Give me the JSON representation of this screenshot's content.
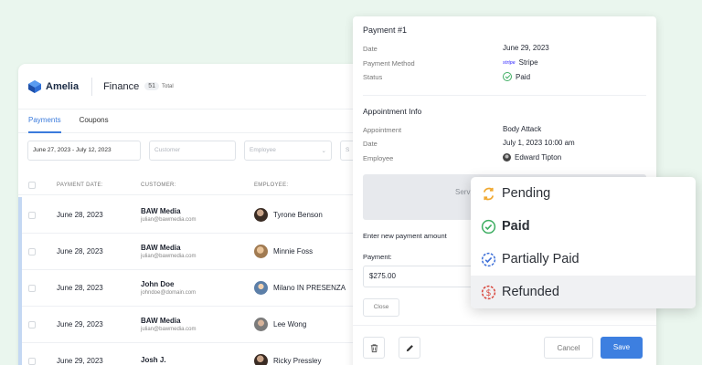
{
  "app": {
    "logo_text": "Amelia",
    "section_title": "Finance",
    "total_count": "51",
    "total_label": "Total"
  },
  "tabs": [
    {
      "label": "Payments",
      "active": true
    },
    {
      "label": "Coupons",
      "active": false
    }
  ],
  "filters": {
    "date_range": "June 27, 2023 - July 12, 2023",
    "customer_placeholder": "Customer",
    "employee_placeholder": "Employee",
    "next_placeholder": "S"
  },
  "table": {
    "headers": [
      "PAYMENT DATE:",
      "CUSTOMER:",
      "EMPLOYEE:"
    ],
    "rows": [
      {
        "date": "June 28, 2023",
        "customer": "BAW Media",
        "email": "julian@bawmedia.com",
        "employee": "Tyrone Benson"
      },
      {
        "date": "June 28, 2023",
        "customer": "BAW Media",
        "email": "julian@bawmedia.com",
        "employee": "Minnie Foss"
      },
      {
        "date": "June 28, 2023",
        "customer": "John Doe",
        "email": "johndoe@domain.com",
        "employee": "Milano IN PRESENZA"
      },
      {
        "date": "June 29, 2023",
        "customer": "BAW Media",
        "email": "julian@bawmedia.com",
        "employee": "Lee Wong"
      },
      {
        "date": "June 29, 2023",
        "customer": "Josh J.",
        "email": "",
        "employee": "Ricky Pressley"
      }
    ]
  },
  "payment": {
    "title": "Payment #1",
    "date_label": "Date",
    "date_value": "June 29, 2023",
    "method_label": "Payment Method",
    "method_value": "Stripe",
    "method_logo": "stripe",
    "status_label": "Status",
    "status_value": "Paid",
    "appointment_section": "Appointment Info",
    "appointment_label": "Appointment",
    "appointment_value": "Body Attack",
    "appt_date_label": "Date",
    "appt_date_value": "July 1, 2023 10:00 am",
    "employee_label": "Employee",
    "employee_value": "Edward Tipton",
    "gray_box_text": "Serv",
    "new_payment_label": "Enter new payment amount",
    "payment_label": "Payment:",
    "payment_value": "$275.00",
    "close_label": "Close",
    "cancel_label": "Cancel",
    "save_label": "Save"
  },
  "status_dropdown": {
    "options": [
      {
        "label": "Pending",
        "icon": "pending-icon",
        "color": "#f0a830"
      },
      {
        "label": "Paid",
        "icon": "paid-icon",
        "color": "#3fae63"
      },
      {
        "label": "Partially Paid",
        "icon": "partially-paid-icon",
        "color": "#3d6fd8"
      },
      {
        "label": "Refunded",
        "icon": "refunded-icon",
        "color": "#d8453b"
      }
    ]
  },
  "colors": {
    "accent": "#3d7fe0",
    "background": "#eaf6ee"
  }
}
